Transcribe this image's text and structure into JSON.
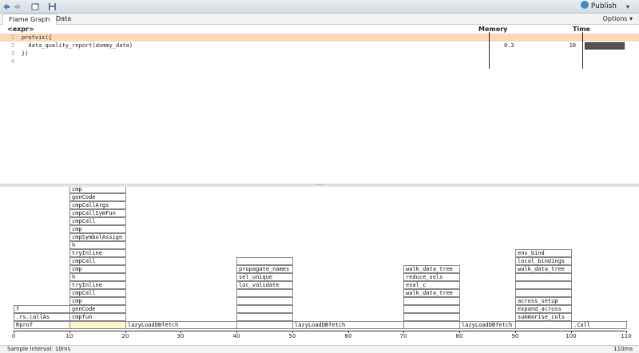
{
  "toolbar": {
    "publish_label": "Publish",
    "icons": [
      "back-arrow-icon",
      "forward-arrow-icon",
      "show-in-window-icon",
      "save-icon",
      "publish-icon"
    ]
  },
  "tabs": [
    {
      "label": "Flame Graph",
      "active": true
    },
    {
      "label": "Data",
      "active": false
    }
  ],
  "options_label": "Options ▾",
  "code_header": {
    "expr": "<expr>",
    "memory": "Memory",
    "time": "Time"
  },
  "code_lines": [
    {
      "num": "1",
      "code": "profvis({",
      "memory": "",
      "time": "",
      "time_fraction": 0,
      "highlight": true
    },
    {
      "num": "2",
      "code": "  data_quality_report(dummy_data)",
      "memory": "0.3",
      "time": "10",
      "time_fraction": 1,
      "highlight": false
    },
    {
      "num": "3",
      "code": "})",
      "memory": "",
      "time": "",
      "time_fraction": 0,
      "highlight": false
    },
    {
      "num": "4",
      "code": "",
      "memory": "",
      "time": "",
      "time_fraction": 0,
      "highlight": false
    }
  ],
  "flame": {
    "cells": [
      {
        "label": "Rprof",
        "start": 0,
        "end": 10,
        "depth": 0
      },
      {
        "label": "",
        "start": 10,
        "end": 20,
        "depth": 0,
        "highlight": true
      },
      {
        "label": "lazyLoadDBfetch",
        "start": 20,
        "end": 40,
        "depth": 0
      },
      {
        "label": "",
        "start": 40,
        "end": 50,
        "depth": 0
      },
      {
        "label": "lazyLoadDBfetch",
        "start": 50,
        "end": 70,
        "depth": 0
      },
      {
        "label": "",
        "start": 70,
        "end": 80,
        "depth": 0
      },
      {
        "label": "lazyLoadDBfetch",
        "start": 80,
        "end": 90,
        "depth": 0
      },
      {
        "label": "",
        "start": 90,
        "end": 100,
        "depth": 0
      },
      {
        "label": ".Call",
        "start": 100,
        "end": 110,
        "depth": 0
      },
      {
        "label": ".rs.callAs",
        "start": 0,
        "end": 10,
        "depth": 1
      },
      {
        "label": "cmpfun",
        "start": 10,
        "end": 20,
        "depth": 1
      },
      {
        "label": "",
        "start": 40,
        "end": 50,
        "depth": 1
      },
      {
        "label": "",
        "start": 70,
        "end": 80,
        "depth": 1
      },
      {
        "label": "summarise_cols",
        "start": 90,
        "end": 100,
        "depth": 1
      },
      {
        "label": "f",
        "start": 0,
        "end": 10,
        "depth": 2
      },
      {
        "label": "genCode",
        "start": 10,
        "end": 20,
        "depth": 2
      },
      {
        "label": "",
        "start": 40,
        "end": 50,
        "depth": 2
      },
      {
        "label": "",
        "start": 70,
        "end": 80,
        "depth": 2
      },
      {
        "label": "expand_across",
        "start": 90,
        "end": 100,
        "depth": 2
      },
      {
        "label": "cmp",
        "start": 10,
        "end": 20,
        "depth": 3
      },
      {
        "label": "",
        "start": 40,
        "end": 50,
        "depth": 3
      },
      {
        "label": "",
        "start": 70,
        "end": 80,
        "depth": 3
      },
      {
        "label": "across_setup",
        "start": 90,
        "end": 100,
        "depth": 3
      },
      {
        "label": "cmpCall",
        "start": 10,
        "end": 20,
        "depth": 4
      },
      {
        "label": "",
        "start": 40,
        "end": 50,
        "depth": 4
      },
      {
        "label": "walk_data_tree",
        "start": 70,
        "end": 80,
        "depth": 4
      },
      {
        "label": "",
        "start": 90,
        "end": 100,
        "depth": 4
      },
      {
        "label": "tryInline",
        "start": 10,
        "end": 20,
        "depth": 5
      },
      {
        "label": "loc_validate",
        "start": 40,
        "end": 50,
        "depth": 5
      },
      {
        "label": "eval_c",
        "start": 70,
        "end": 80,
        "depth": 5
      },
      {
        "label": "",
        "start": 90,
        "end": 100,
        "depth": 5
      },
      {
        "label": "h",
        "start": 10,
        "end": 20,
        "depth": 6
      },
      {
        "label": "sel_unique",
        "start": 40,
        "end": 50,
        "depth": 6
      },
      {
        "label": "reduce_sels",
        "start": 70,
        "end": 80,
        "depth": 6
      },
      {
        "label": "",
        "start": 90,
        "end": 100,
        "depth": 6
      },
      {
        "label": "cmp",
        "start": 10,
        "end": 20,
        "depth": 7
      },
      {
        "label": "propagate_names",
        "start": 40,
        "end": 50,
        "depth": 7
      },
      {
        "label": "walk_data_tree",
        "start": 70,
        "end": 80,
        "depth": 7
      },
      {
        "label": "walk_data_tree",
        "start": 90,
        "end": 100,
        "depth": 7
      },
      {
        "label": "cmpCall",
        "start": 10,
        "end": 20,
        "depth": 8
      },
      {
        "label": "",
        "start": 40,
        "end": 50,
        "depth": 8
      },
      {
        "label": "local_bindings",
        "start": 90,
        "end": 100,
        "depth": 8
      },
      {
        "label": "tryInline",
        "start": 10,
        "end": 20,
        "depth": 9
      },
      {
        "label": "env_bind",
        "start": 90,
        "end": 100,
        "depth": 9
      },
      {
        "label": "h",
        "start": 10,
        "end": 20,
        "depth": 10
      },
      {
        "label": "cmpSymbolAssign",
        "start": 10,
        "end": 20,
        "depth": 11
      },
      {
        "label": "cmp",
        "start": 10,
        "end": 20,
        "depth": 12
      },
      {
        "label": "cmpCall",
        "start": 10,
        "end": 20,
        "depth": 13
      },
      {
        "label": "cmpCallSymFun",
        "start": 10,
        "end": 20,
        "depth": 14
      },
      {
        "label": "cmpCallArgs",
        "start": 10,
        "end": 20,
        "depth": 15
      },
      {
        "label": "genCode",
        "start": 10,
        "end": 20,
        "depth": 16
      },
      {
        "label": "cmp",
        "start": 10,
        "end": 20,
        "depth": 17
      }
    ]
  },
  "axis": {
    "ticks": [
      "0",
      "10",
      "20",
      "30",
      "40",
      "50",
      "60",
      "70",
      "80",
      "90",
      "100",
      "110"
    ]
  },
  "status": {
    "sample_interval": "Sample Interval: 10ms",
    "total": "110ms"
  }
}
